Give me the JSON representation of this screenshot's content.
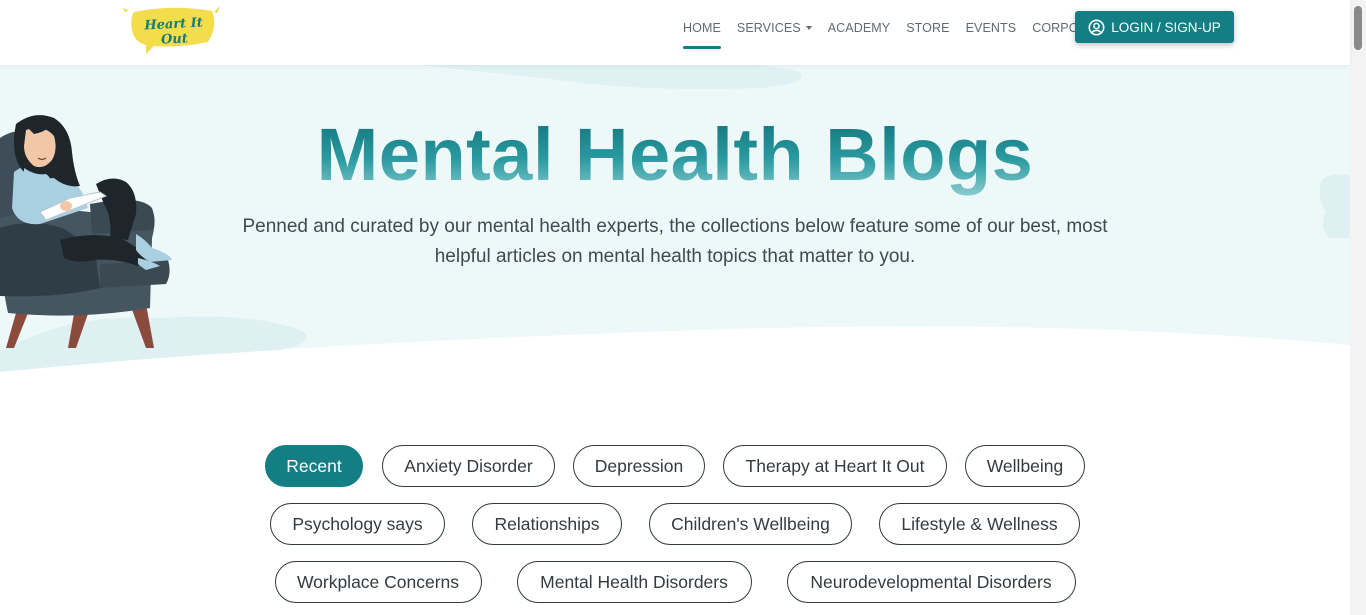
{
  "brand": {
    "logo_text": "Heart It Out"
  },
  "nav": {
    "items": [
      {
        "label": "HOME",
        "active": true
      },
      {
        "label": "SERVICES",
        "dropdown": true
      },
      {
        "label": "ACADEMY"
      },
      {
        "label": "STORE"
      },
      {
        "label": "EVENTS"
      },
      {
        "label": "CORPORATE"
      }
    ],
    "login_label": "LOGIN / SIGN-UP",
    "login_icon": "user-circle-icon"
  },
  "hero": {
    "title": "Mental Health Blogs",
    "subtitle_line1": "Penned and curated by our mental health experts, the collections below feature some of our best, most",
    "subtitle_line2": "helpful articles on mental health topics that matter to you."
  },
  "categories": {
    "rows": [
      [
        "Recent",
        "Anxiety Disorder",
        "Depression",
        "Therapy at Heart It Out",
        "Wellbeing"
      ],
      [
        "Psychology says",
        "Relationships",
        "Children's Wellbeing",
        "Lifestyle & Wellness"
      ],
      [
        "Workplace Concerns",
        "Mental Health Disorders",
        "Neurodevelopmental Disorders"
      ]
    ],
    "selected": "Recent"
  },
  "colors": {
    "accent": "#137f84",
    "hero_background": "#edf8f9",
    "text": "#3f4a52"
  }
}
